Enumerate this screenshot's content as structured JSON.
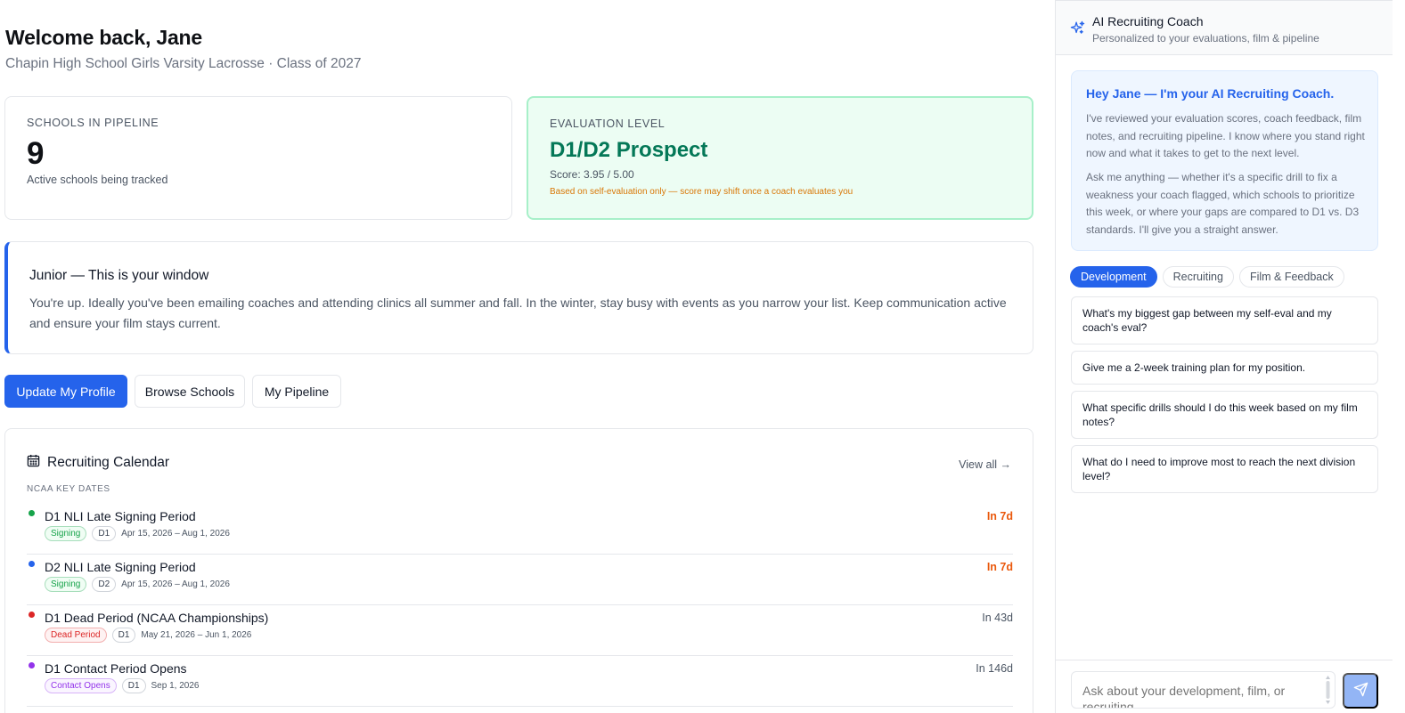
{
  "header": {
    "welcome": "Welcome back, Jane",
    "subtitle": "Chapin High School Girls Varsity Lacrosse · Class of 2027"
  },
  "stats": {
    "schools": {
      "label": "SCHOOLS IN PIPELINE",
      "value": "9",
      "desc": "Active schools being tracked"
    },
    "evaluation": {
      "label": "EVALUATION LEVEL",
      "value": "D1/D2 Prospect",
      "score": "Score: 3.95 / 5.00",
      "note": "Based on self-evaluation only — score may shift once a coach evaluates you"
    }
  },
  "window": {
    "title": "Junior — This is your window",
    "text": "You're up. Ideally you've been emailing coaches and attending clinics all summer and fall. In the winter, stay busy with events as you narrow your list. Keep communication active and ensure your film stays current."
  },
  "actions": {
    "update_profile": "Update My Profile",
    "browse_schools": "Browse Schools",
    "my_pipeline": "My Pipeline"
  },
  "calendar": {
    "title": "Recruiting Calendar",
    "view_all": "View all →",
    "section": "NCAA KEY DATES",
    "items": [
      {
        "name": "D1 NLI Late Signing Period",
        "tag": "Signing",
        "tag_color": "#16a34a",
        "tag_bg": "#f0fdf4",
        "division": "D1",
        "dates": "Apr 15, 2026 – Aug 1, 2026",
        "when": "In 7d",
        "when_color": "#ea580c",
        "dot": "#16a34a"
      },
      {
        "name": "D2 NLI Late Signing Period",
        "tag": "Signing",
        "tag_color": "#16a34a",
        "tag_bg": "#f0fdf4",
        "division": "D2",
        "dates": "Apr 15, 2026 – Aug 1, 2026",
        "when": "In 7d",
        "when_color": "#ea580c",
        "dot": "#2563eb"
      },
      {
        "name": "D1 Dead Period (NCAA Championships)",
        "tag": "Dead Period",
        "tag_color": "#dc2626",
        "tag_bg": "#fef2f2",
        "division": "D1",
        "dates": "May 21, 2026 – Jun 1, 2026",
        "when": "In 43d",
        "when_color": "#4b5563",
        "dot": "#dc2626"
      },
      {
        "name": "D1 Contact Period Opens",
        "tag": "Contact Opens",
        "tag_color": "#9333ea",
        "tag_bg": "#faf5ff",
        "division": "D1",
        "dates": "Sep 1, 2026",
        "when": "In 146d",
        "when_color": "#4b5563",
        "dot": "#9333ea"
      }
    ]
  },
  "coach": {
    "title": "AI Recruiting Coach",
    "subtitle": "Personalized to your evaluations, film & pipeline",
    "intro_title": "Hey Jane — I'm your AI Recruiting Coach.",
    "intro_p1": "I've reviewed your evaluation scores, coach feedback, film notes, and recruiting pipeline. I know where you stand right now and what it takes to get to the next level.",
    "intro_p2": "Ask me anything — whether it's a specific drill to fix a weakness your coach flagged, which schools to prioritize this week, or where your gaps are compared to D1 vs. D3 standards. I'll give you a straight answer.",
    "tabs": [
      "Development",
      "Recruiting",
      "Film & Feedback"
    ],
    "suggestions": [
      "What's my biggest gap between my self-eval and my coach's eval?",
      "Give me a 2-week training plan for my position.",
      "What specific drills should I do this week based on my film notes?",
      "What do I need to improve most to reach the next division level?"
    ],
    "input_placeholder": "Ask about your development, film, or recruiting...",
    "accent": "#2563eb"
  }
}
